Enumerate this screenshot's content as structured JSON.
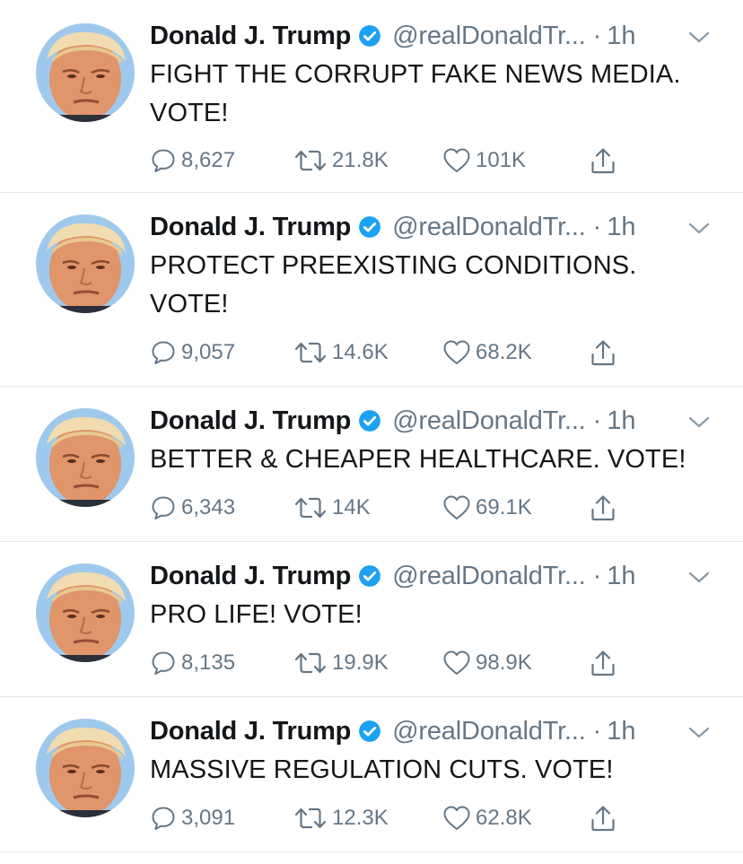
{
  "accent_color": "#1da1f2",
  "muted_color": "#657786",
  "tweets": [
    {
      "name": "Donald J. Trump",
      "handle": "@realDonaldTr...",
      "separator": "·",
      "time": "1h",
      "text": "FIGHT THE CORRUPT FAKE NEWS MEDIA. VOTE!",
      "replies": "8,627",
      "retweets": "21.8K",
      "likes": "101K",
      "icons": [
        "verified-badge-icon",
        "chevron-down-icon",
        "reply-icon",
        "retweet-icon",
        "like-icon",
        "share-icon"
      ]
    },
    {
      "name": "Donald J. Trump",
      "handle": "@realDonaldTr...",
      "separator": "·",
      "time": "1h",
      "text": "PROTECT PREEXISTING CONDITIONS. VOTE!",
      "replies": "9,057",
      "retweets": "14.6K",
      "likes": "68.2K",
      "icons": [
        "verified-badge-icon",
        "chevron-down-icon",
        "reply-icon",
        "retweet-icon",
        "like-icon",
        "share-icon"
      ]
    },
    {
      "name": "Donald J. Trump",
      "handle": "@realDonaldTr...",
      "separator": "·",
      "time": "1h",
      "text": "BETTER & CHEAPER HEALTHCARE. VOTE!",
      "replies": "6,343",
      "retweets": "14K",
      "likes": "69.1K",
      "icons": [
        "verified-badge-icon",
        "chevron-down-icon",
        "reply-icon",
        "retweet-icon",
        "like-icon",
        "share-icon"
      ]
    },
    {
      "name": "Donald J. Trump",
      "handle": "@realDonaldTr...",
      "separator": "·",
      "time": "1h",
      "text": "PRO LIFE! VOTE!",
      "replies": "8,135",
      "retweets": "19.9K",
      "likes": "98.9K",
      "icons": [
        "verified-badge-icon",
        "chevron-down-icon",
        "reply-icon",
        "retweet-icon",
        "like-icon",
        "share-icon"
      ]
    },
    {
      "name": "Donald J. Trump",
      "handle": "@realDonaldTr...",
      "separator": "·",
      "time": "1h",
      "text": "MASSIVE REGULATION CUTS. VOTE!",
      "replies": "3,091",
      "retweets": "12.3K",
      "likes": "62.8K",
      "icons": [
        "verified-badge-icon",
        "chevron-down-icon",
        "reply-icon",
        "retweet-icon",
        "like-icon",
        "share-icon"
      ]
    }
  ]
}
